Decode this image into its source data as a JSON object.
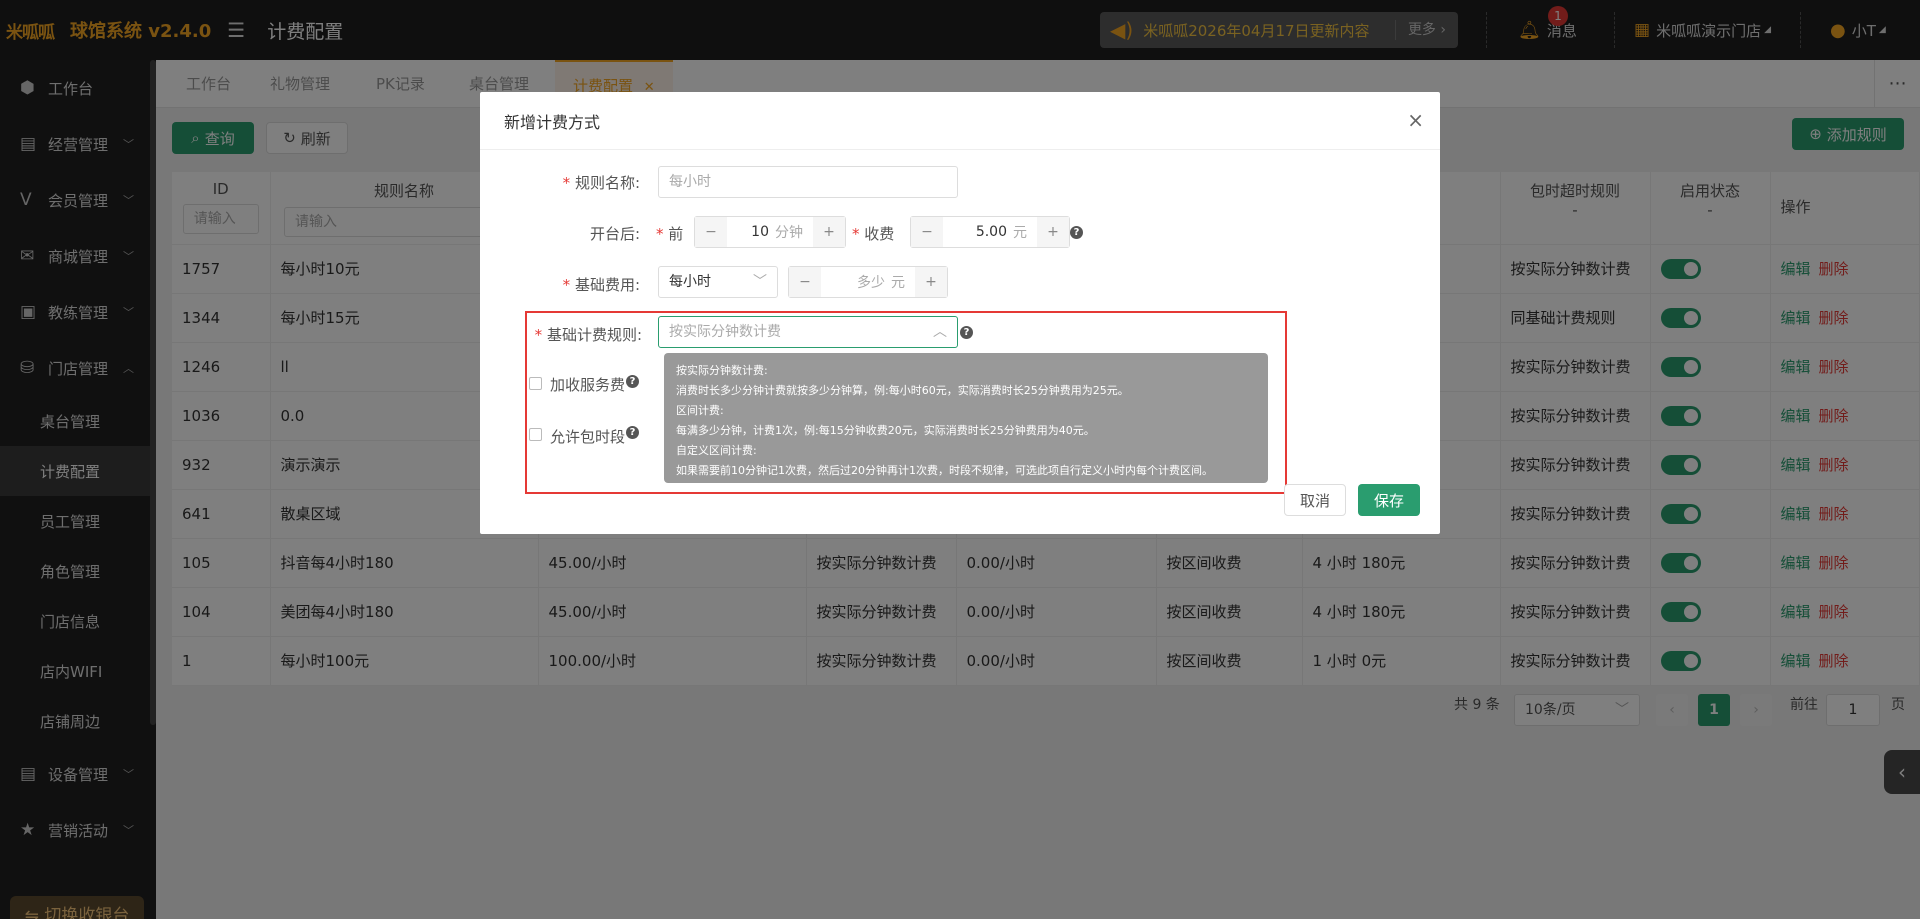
{
  "topbar": {
    "logo": "米呱呱",
    "app_title": "球馆系统 v2.4.0",
    "page_title": "计费配置",
    "notice_text": "米呱呱2026年04月17日更新内容",
    "notice_more": "更多",
    "messages_label": "消息",
    "messages_count": "1",
    "store_label": "米呱呱演示门店",
    "user_label": "小T"
  },
  "sidebar": {
    "items": [
      {
        "label": "工作台",
        "icon": "cube-icon"
      },
      {
        "label": "经营管理",
        "icon": "store-icon"
      },
      {
        "label": "会员管理",
        "icon": "vip-icon"
      },
      {
        "label": "商城管理",
        "icon": "mail-icon"
      },
      {
        "label": "教练管理",
        "icon": "coach-icon"
      },
      {
        "label": "门店管理",
        "icon": "coins-icon"
      }
    ],
    "subitems": [
      "桌台管理",
      "计费配置",
      "员工管理",
      "角色管理",
      "门店信息",
      "店内WIFI",
      "店铺周边"
    ],
    "bottom_items": [
      {
        "label": "设备管理",
        "icon": "device-icon"
      },
      {
        "label": "营销活动",
        "icon": "star-icon"
      }
    ],
    "switch_label": "⇋ 切换收银台"
  },
  "tabs": [
    "工作台",
    "礼物管理",
    "PK记录",
    "桌台管理",
    "计费配置"
  ],
  "toolbar": {
    "query_label": "查询",
    "refresh_label": "刷新",
    "add_rule_label": "添加规则"
  },
  "table": {
    "headers": {
      "id": "ID",
      "name": "规则名称",
      "overtime_rule": "包时超时规则",
      "overtime_sub": "-",
      "status": "启用状态",
      "status_sub": "-",
      "ops": "操作",
      "filter_placeholder": "请输入"
    },
    "rows": [
      {
        "id": "1757",
        "name": "每小时10元",
        "price": "",
        "mode": "",
        "extra": "",
        "pkg": "",
        "pkgval": "",
        "overtime": "按实际分钟数计费"
      },
      {
        "id": "1344",
        "name": "每小时15元",
        "price": "",
        "mode": "",
        "extra": "",
        "pkg": "",
        "pkgval": "",
        "overtime": "同基础计费规则"
      },
      {
        "id": "1246",
        "name": "ll",
        "price": "",
        "mode": "",
        "extra": "",
        "pkg": "",
        "pkgval": "",
        "overtime": "按实际分钟数计费"
      },
      {
        "id": "1036",
        "name": "0.0",
        "price": "",
        "mode": "",
        "extra": "",
        "pkg": "",
        "pkgval": "",
        "overtime": "按实际分钟数计费"
      },
      {
        "id": "932",
        "name": "演示演示",
        "price": "",
        "mode": "",
        "extra": "",
        "pkg": "",
        "pkgval": "",
        "overtime": "按实际分钟数计费"
      },
      {
        "id": "641",
        "name": "散桌区域",
        "price": "",
        "mode": "",
        "extra": "",
        "pkg": "",
        "pkgval": "",
        "overtime": "按实际分钟数计费"
      },
      {
        "id": "105",
        "name": "抖音每4小时180",
        "price": "45.00/小时",
        "mode": "按实际分钟数计费",
        "extra": "0.00/小时",
        "pkg": "按区间收费",
        "pkgval": "4 小时 180元",
        "overtime": "按实际分钟数计费"
      },
      {
        "id": "104",
        "name": "美团每4小时180",
        "price": "45.00/小时",
        "mode": "按实际分钟数计费",
        "extra": "0.00/小时",
        "pkg": "按区间收费",
        "pkgval": "4 小时 180元",
        "overtime": "按实际分钟数计费"
      },
      {
        "id": "1",
        "name": "每小时100元",
        "price": "100.00/小时",
        "mode": "按实际分钟数计费",
        "extra": "0.00/小时",
        "pkg": "按区间收费",
        "pkgval": "1 小时 0元",
        "overtime": "按实际分钟数计费"
      }
    ],
    "edit_label": "编辑",
    "delete_label": "删除"
  },
  "pagination": {
    "total": "共 9 条",
    "page_size": "10条/页",
    "current": "1",
    "goto_label": "前往",
    "goto_value": "1",
    "page_suffix": "页"
  },
  "dialog": {
    "title": "新增计费方式",
    "rule_name_label": "规则名称:",
    "rule_name_placeholder": "每小时",
    "open_label": "开台后:",
    "before_label": "前",
    "before_value": "10",
    "before_unit": "分钟",
    "charge_label": "收费",
    "charge_value": "5.00",
    "charge_unit": "元",
    "base_fee_label": "基础费用:",
    "base_fee_select": "每小时",
    "base_fee_placeholder": "多少",
    "base_fee_unit": "元",
    "base_rule_label": "基础计费规则:",
    "base_rule_placeholder": "按实际分钟数计费",
    "extra_service_label": "加收服务费",
    "allow_package_label": "允许包时段",
    "tooltip_lines": [
      "按实际分钟数计费:",
      "消费时长多少分钟计费就按多少分钟算，例:每小时60元，实际消费时长25分钟费用为25元。",
      "区间计费:",
      "每满多少分钟，计费1次，例:每15分钟收费20元，实际消费时长25分钟费用为40元。",
      "自定义区间计费:",
      "如果需要前10分钟记1次费，然后过20分钟再计1次费，时段不规律，可选此项自行定义小时内每个计费区间。"
    ],
    "cancel_label": "取消",
    "save_label": "保存"
  },
  "colors": {
    "brand": "#f5a623",
    "green": "#2a9d6f",
    "danger": "#e53935"
  }
}
